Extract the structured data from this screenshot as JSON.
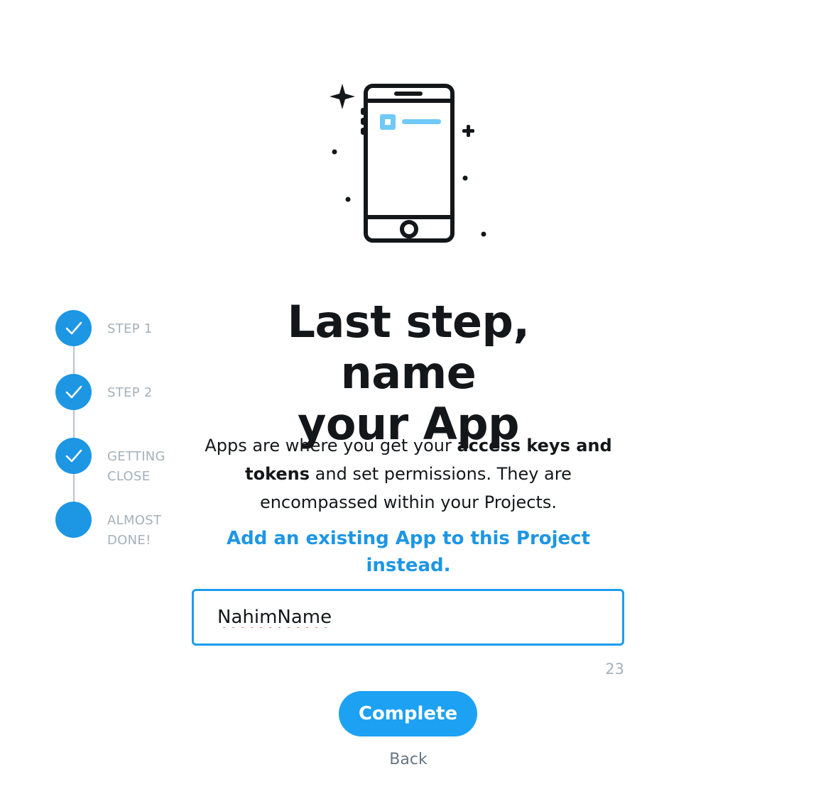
{
  "illustration": {
    "icon": "smartphone-icon"
  },
  "stepper": {
    "steps": [
      {
        "label": "STEP 1",
        "state": "completed",
        "icon": "check-icon"
      },
      {
        "label": "STEP 2",
        "state": "completed",
        "icon": "check-icon"
      },
      {
        "label_lines": [
          "GETTING",
          "CLOSE"
        ],
        "state": "completed",
        "icon": "check-icon"
      },
      {
        "label_lines": [
          "ALMOST",
          "DONE!"
        ],
        "state": "current"
      }
    ]
  },
  "main": {
    "title_line1": "Last step, name",
    "title_line2": "your App",
    "description": {
      "part1": "Apps are where you get your ",
      "bold1": "access keys and",
      "bold2": "tokens",
      "part2": " and set permissions. They are",
      "part3": "encompassed within your Projects."
    },
    "existing_app_link": "Add an existing App to this Project instead.",
    "app_name_value": "NahimName",
    "char_counter": "23",
    "complete_label": "Complete",
    "back_label": "Back"
  },
  "colors": {
    "accent": "#1da1f2",
    "step_circle": "#1d96e4",
    "muted_text": "#a4b1bb",
    "heading": "#14171a"
  }
}
